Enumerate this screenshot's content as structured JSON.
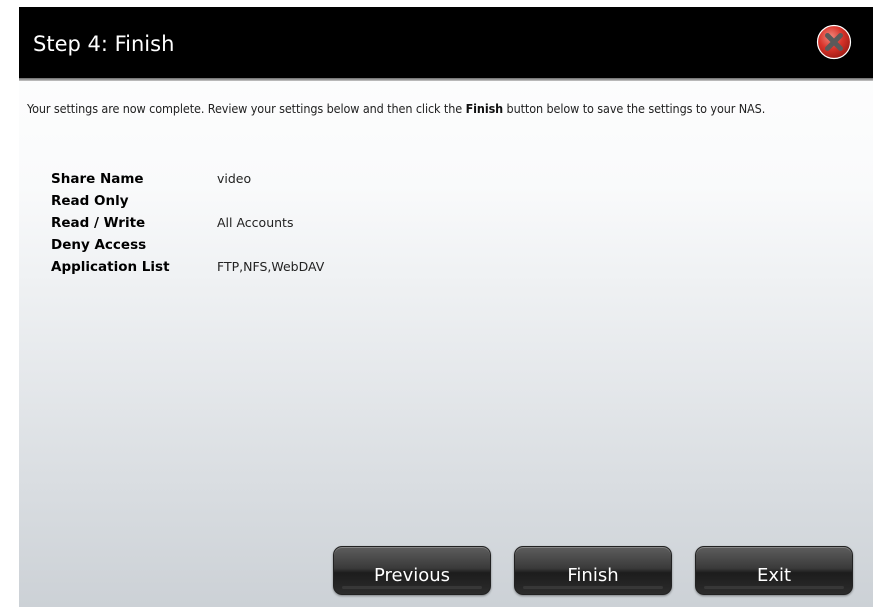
{
  "dialog": {
    "title": "Step 4: Finish",
    "close_icon": "close-x-icon",
    "close_icon_color": "#d9342b",
    "title_bar_color": "#000000"
  },
  "intro": {
    "text_before": "Your settings are now complete. Review your settings below and then click the ",
    "bold_word": "Finish",
    "text_after": " button below to save the settings to your NAS."
  },
  "summary": [
    {
      "label": "Share Name",
      "value": "video"
    },
    {
      "label": "Read Only",
      "value": ""
    },
    {
      "label": "Read / Write",
      "value": "All Accounts"
    },
    {
      "label": "Deny Access",
      "value": ""
    },
    {
      "label": "Application List",
      "value": "FTP,NFS,WebDAV"
    }
  ],
  "buttons": {
    "previous_label": "Previous",
    "finish_label": "Finish",
    "exit_label": "Exit"
  }
}
